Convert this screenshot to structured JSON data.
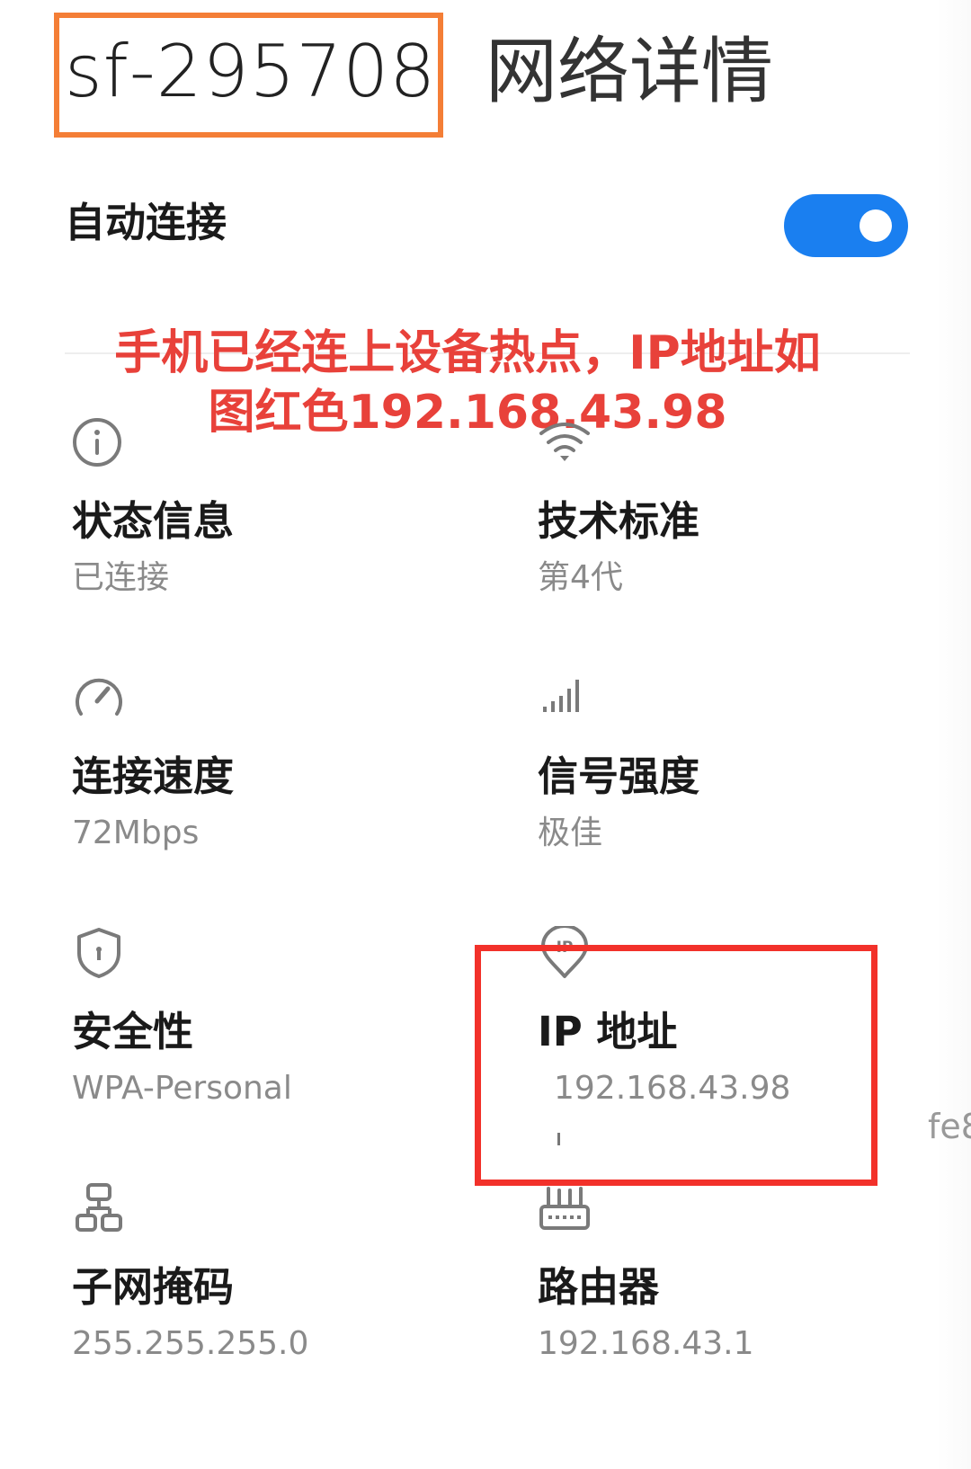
{
  "header": {
    "ssid": "sf-295708",
    "title_suffix": "网络详情"
  },
  "auto_connect": {
    "label": "自动连接",
    "enabled": true
  },
  "annotation": {
    "line1": "手机已经连上设备热点，IP地址如",
    "line2": "图红色192.168.43.98",
    "color": "#e8413a"
  },
  "details": [
    {
      "icon": "info-icon",
      "label": "状态信息",
      "value": "已连接"
    },
    {
      "icon": "wifi-icon",
      "label": "技术标准",
      "value": "第4代"
    },
    {
      "icon": "speedometer-icon",
      "label": "连接速度",
      "value": "72Mbps"
    },
    {
      "icon": "signal-bars-icon",
      "label": "信号强度",
      "value": "极佳"
    },
    {
      "icon": "shield-icon",
      "label": "安全性",
      "value": "WPA-Personal"
    },
    {
      "icon": "ip-location-icon",
      "label": "IP 地址",
      "value": "192.168.43.98"
    },
    {
      "icon": "network-topology-icon",
      "label": "子网掩码",
      "value": "255.255.255.0"
    },
    {
      "icon": "router-icon",
      "label": "路由器",
      "value": "192.168.43.1"
    }
  ],
  "cutoff_text": "fe8",
  "colors": {
    "toggle_on": "#1a7ff0",
    "ssid_highlight": "#f47e36",
    "ip_highlight": "#f2312a"
  }
}
